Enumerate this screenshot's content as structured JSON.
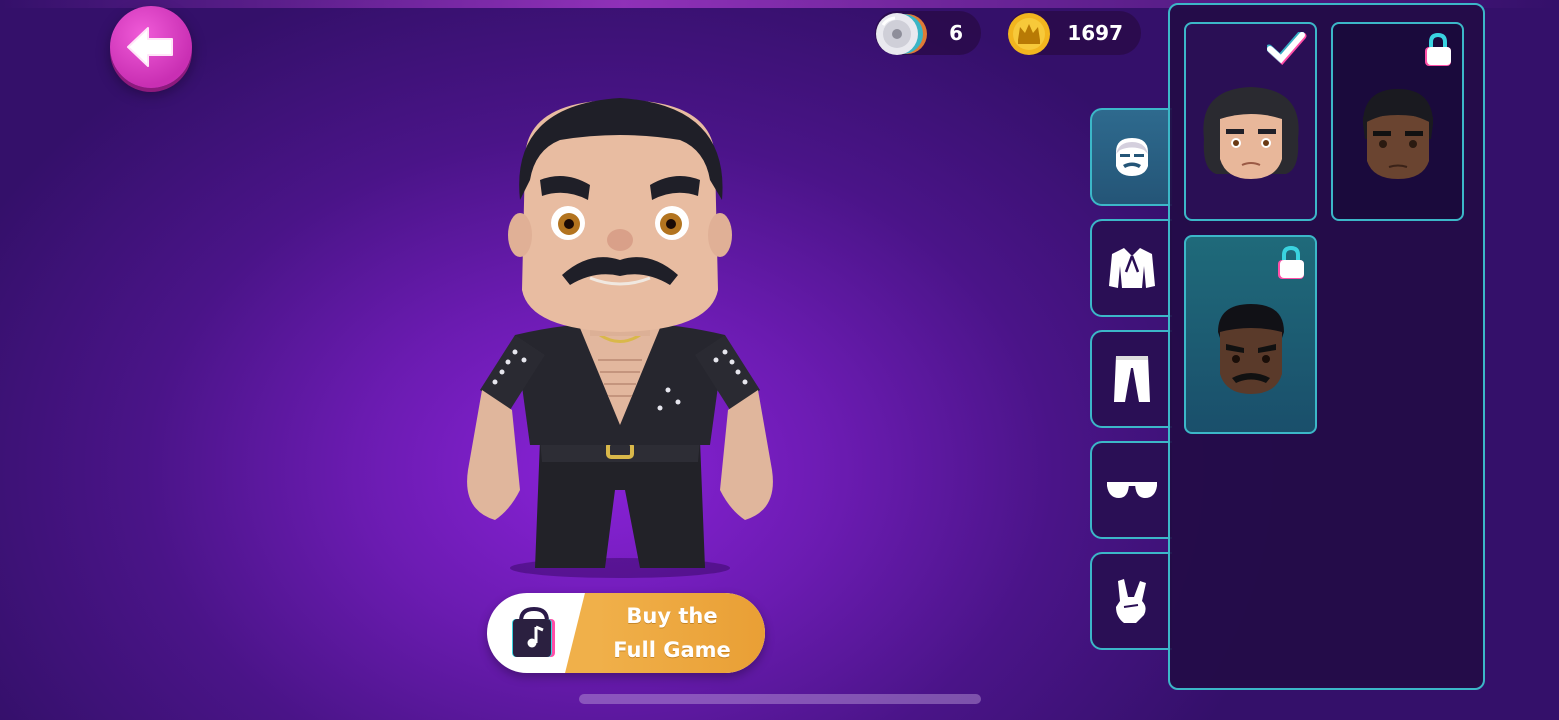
{
  "currency": {
    "records": {
      "icon": "vinyl-record-icon",
      "amount": "6"
    },
    "coins": {
      "icon": "crown-coin-icon",
      "amount": "1697"
    }
  },
  "navigation": {
    "back_icon": "back-arrow-icon"
  },
  "buy_button": {
    "icon": "music-shopping-bag-icon",
    "line1": "Buy the",
    "line2": "Full Game"
  },
  "categories": [
    {
      "id": "head",
      "icon": "head-icon",
      "active": true
    },
    {
      "id": "jacket",
      "icon": "jacket-icon",
      "active": false
    },
    {
      "id": "pants",
      "icon": "pants-icon",
      "active": false
    },
    {
      "id": "glasses",
      "icon": "sunglasses-icon",
      "active": false
    },
    {
      "id": "gesture",
      "icon": "rock-hand-icon",
      "active": false
    }
  ],
  "heads": [
    {
      "id": "head-1",
      "status": "selected",
      "badge_icon": "checkmark-icon",
      "skin": "#e8b79a",
      "hair": "long"
    },
    {
      "id": "head-2",
      "status": "locked",
      "badge_icon": "lock-icon",
      "skin": "#6a4430",
      "hair": "bowl"
    },
    {
      "id": "head-3",
      "status": "locked",
      "badge_icon": "lock-icon",
      "skin": "#5a3a2a",
      "hair": "short"
    }
  ],
  "colors": {
    "accent_pink": "#d43ec0",
    "panel_border": "#3cb7c8",
    "buy_orange": "#eea63f"
  }
}
